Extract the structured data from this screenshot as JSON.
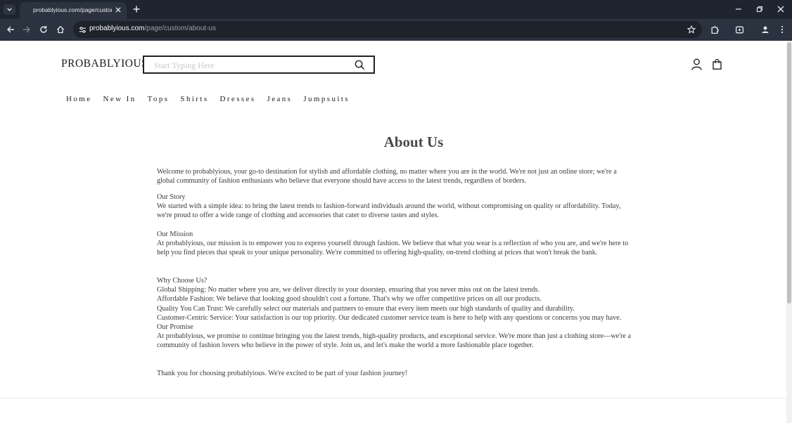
{
  "browser": {
    "tab_title": "probablyious.com/page/custom/about-us",
    "url_host": "probablyious.com",
    "url_path": "/page/custom/about-us"
  },
  "header": {
    "logo": "PROBABLYIOUS",
    "search_placeholder": "Start Typing Here"
  },
  "nav": {
    "items": [
      "Home",
      "New In",
      "Tops",
      "Shirts",
      "Dresses",
      "Jeans",
      "Jumpsuits"
    ]
  },
  "content": {
    "title": "About Us",
    "intro": "Welcome to probablyious, your go-to destination for stylish and affordable clothing, no matter where you are in the world. We're not just an online store; we're a global community of fashion enthusiasts who believe that everyone should have access to the latest trends, regardless of borders.",
    "story_heading": "Our Story",
    "story_text": "We started with a simple idea: to bring the latest trends to fashion-forward individuals around the world, without compromising on quality or affordability. Today, we're proud to offer a wide range of clothing and accessories that cater to diverse tastes and styles.",
    "mission_heading": "Our Mission",
    "mission_text": "At probablyious, our mission is to empower you to express yourself through fashion. We believe that what you wear is a reflection of who you are, and we're here to help you find pieces that speak to your unique personality. We're committed to offering high-quality, on-trend clothing at prices that won't break the bank.",
    "why_heading": "Why Choose Us?",
    "why_shipping": "Global Shipping: No matter where you are, we deliver directly to your doorstep, ensuring that you never miss out on the latest trends.",
    "why_affordable": "Affordable Fashion: We believe that looking good shouldn't cost a fortune. That's why we offer competitive prices on all our products.",
    "why_quality": "Quality You Can Trust: We carefully select our materials and partners to ensure that every item meets our high standards of quality and durability.",
    "why_service": "Customer-Centric Service: Your satisfaction is our top priority. Our dedicated customer service team is here to help with any questions or concerns you may have.",
    "promise_heading": "Our Promise",
    "promise_text": "At probablyious, we promise to continue bringing you the latest trends, high-quality products, and exceptional service. We're more than just a clothing store—we're a community of fashion lovers who believe in the power of style. Join us, and let's make the world a more fashionable place together.",
    "thanks": "Thank you for choosing probablyious. We're excited to be part of your fashion journey!"
  },
  "colors": {
    "chrome_dark": "#1f2530",
    "chrome_toolbar": "#2b3340",
    "text": "#3a3a3a"
  }
}
